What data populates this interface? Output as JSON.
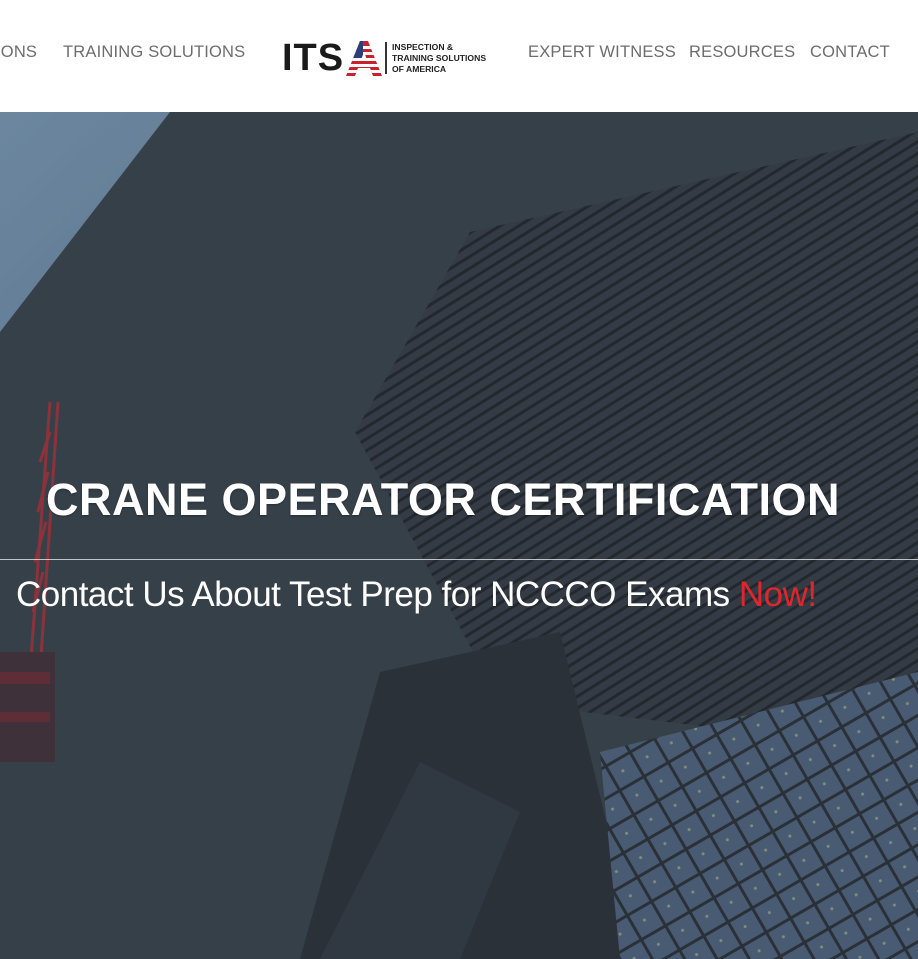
{
  "nav": {
    "left_items": [
      {
        "label": "IONS"
      },
      {
        "label": "TRAINING SOLUTIONS"
      }
    ],
    "right_items": [
      {
        "label": "EXPERT WITNESS"
      },
      {
        "label": "RESOURCES"
      },
      {
        "label": "CONTACT"
      }
    ],
    "logo": {
      "letters": "ITSA",
      "tagline_1": "INSPECTION &",
      "tagline_2": "TRAINING SOLUTIONS",
      "tagline_3": "OF AMERICA"
    }
  },
  "hero": {
    "title": "CRANE OPERATOR CERTIFICATION",
    "subtitle_prefix": "Contact Us About Test Prep for NCCCO Exams ",
    "subtitle_highlight": "Now!"
  },
  "colors": {
    "accent_red": "#e0262b",
    "nav_text": "#6d6d6d",
    "overlay": "#3a434c"
  }
}
